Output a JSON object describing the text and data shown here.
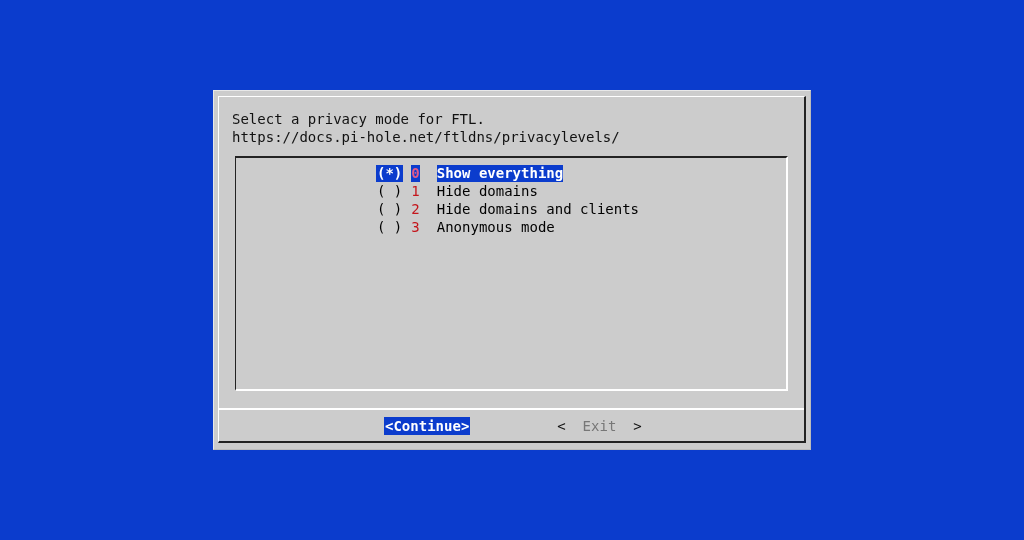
{
  "message": [
    "Select a privacy mode for FTL.",
    "https://docs.pi-hole.net/ftldns/privacylevels/"
  ],
  "options": [
    {
      "marker": "(*)",
      "number": "0",
      "label": "Show everything",
      "selected": true
    },
    {
      "marker": "( )",
      "number": "1",
      "label": "Hide domains",
      "selected": false
    },
    {
      "marker": "( )",
      "number": "2",
      "label": "Hide domains and clients",
      "selected": false
    },
    {
      "marker": "( )",
      "number": "3",
      "label": "Anonymous mode",
      "selected": false
    }
  ],
  "buttons": [
    {
      "open": "<",
      "label": "Continue",
      "close": ">",
      "selected": true
    },
    {
      "open": "<",
      "label": "Exit",
      "close": ">",
      "selected": false
    }
  ]
}
